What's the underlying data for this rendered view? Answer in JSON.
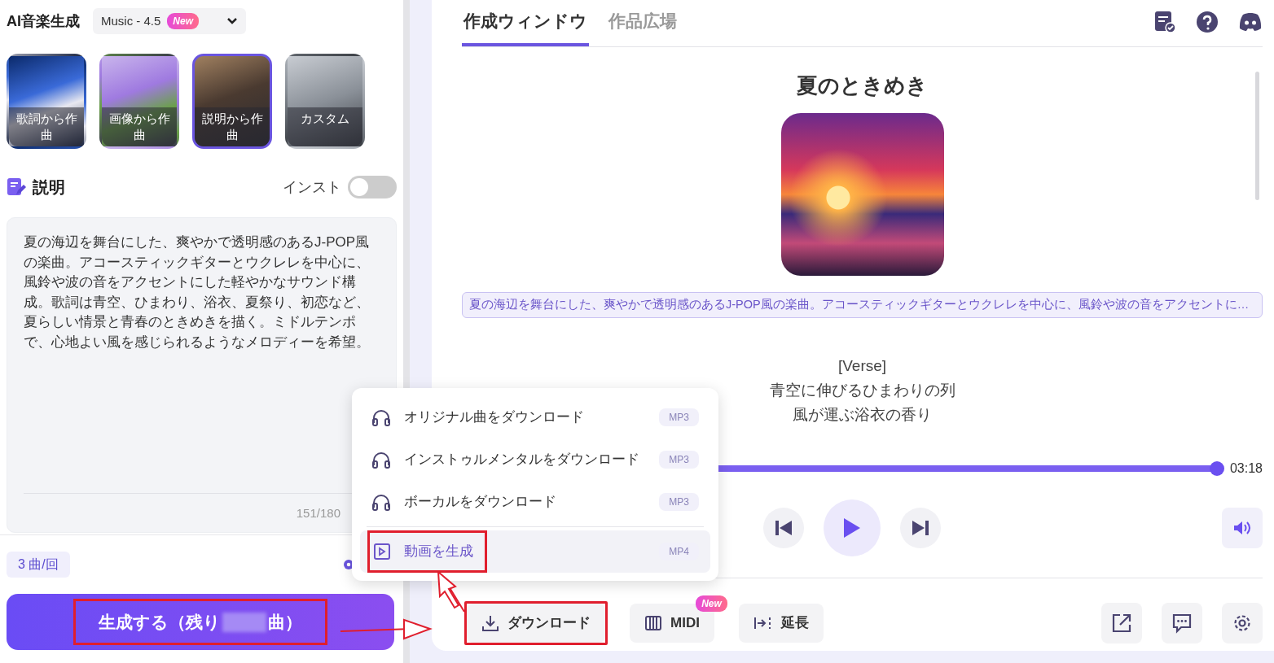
{
  "header": {
    "title": "AI音楽生成",
    "model": {
      "label": "Music - 4.5",
      "badge": "New"
    }
  },
  "modes": [
    {
      "label": "歌詞から作曲",
      "selected": false
    },
    {
      "label": "画像から作曲",
      "selected": false
    },
    {
      "label": "説明から作曲",
      "selected": true
    },
    {
      "label": "カスタム",
      "selected": false
    }
  ],
  "description": {
    "heading": "説明",
    "instrumental": {
      "label": "インスト",
      "on": false
    },
    "text": "夏の海辺を舞台にした、爽やかで透明感のあるJ-POP風の楽曲。アコースティックギターとウクレレを中心に、風鈴や波の音をアクセントにした軽やかなサウンド構成。歌詞は青空、ひまわり、浴衣、夏祭り、初恋など、夏らしい情景と青春のときめきを描く。ミドルテンポで、心地よい風を感じられるようなメロディーを希望。",
    "counter": "151/180"
  },
  "per_run": "3 曲/回",
  "generate": {
    "label": "生成する（残り",
    "suffix": "曲）",
    "highlighted": true
  },
  "tabs": [
    {
      "label": "作成ウィンドウ",
      "selected": true
    },
    {
      "label": "作品広場",
      "selected": false
    }
  ],
  "song": {
    "title": "夏のときめき",
    "prompt": "夏の海辺を舞台にした、爽やかで透明感のあるJ-POP風の楽曲。アコースティックギターとウクレレを中心に、風鈴や波の音をアクセントに…",
    "lyrics": [
      "[Verse]",
      "青空に伸びるひまわりの列",
      "風が運ぶ浴衣の香り"
    ]
  },
  "player": {
    "level": 1,
    "duration": "03:18"
  },
  "actions": [
    {
      "kind": "download",
      "label": "ダウンロード",
      "highlighted": true
    },
    {
      "kind": "midi",
      "label": "MIDI",
      "badge": "New",
      "highlighted": false
    },
    {
      "kind": "extend",
      "label": "延長",
      "highlighted": false
    }
  ],
  "download_menu": [
    {
      "kind": "audio",
      "label": "オリジナル曲をダウンロード",
      "format": "MP3",
      "selected": false,
      "highlighted": false
    },
    {
      "kind": "audio",
      "label": "インストゥルメンタルをダウンロード",
      "format": "MP3",
      "selected": false,
      "highlighted": false
    },
    {
      "kind": "audio",
      "label": "ボーカルをダウンロード",
      "format": "MP3",
      "selected": false,
      "highlighted": false
    },
    {
      "kind": "video",
      "label": "動画を生成",
      "format": "MP4",
      "selected": true,
      "highlighted": true
    }
  ]
}
